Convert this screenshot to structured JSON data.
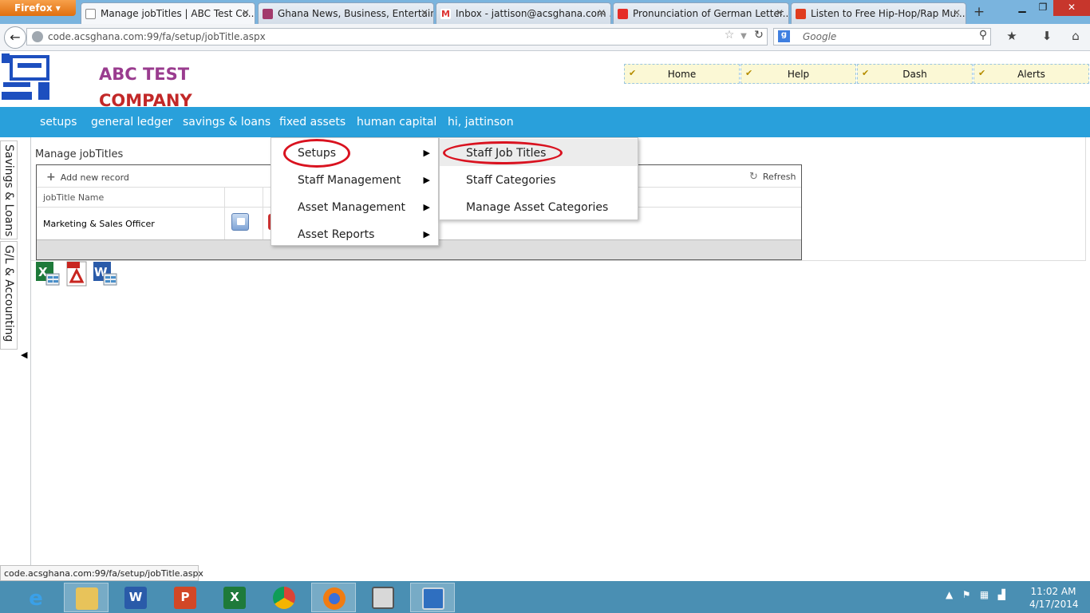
{
  "browser": {
    "menu_label": "Firefox",
    "tabs": [
      {
        "title": "Manage jobTitles | ABC Test Co..."
      },
      {
        "title": "Ghana News, Business, Entertain..."
      },
      {
        "title": "Inbox - jattison@acsghana.com ..."
      },
      {
        "title": "Pronunciation of German Letter..."
      },
      {
        "title": "Listen to Free Hip-Hop/Rap Mu..."
      }
    ],
    "new_tab": "+",
    "url": "code.acsghana.com:99/fa/setup/jobTitle.aspx",
    "search_placeholder": "Google",
    "status_url": "code.acsghana.com:99/fa/setup/jobTitle.aspx"
  },
  "header": {
    "company_line1": "ABC TEST",
    "company_line2": "COMPANY",
    "quicknav": [
      "Home",
      "Help",
      "Dash",
      "Alerts"
    ]
  },
  "mainmenu": [
    "setups",
    "general ledger",
    "savings & loans",
    "fixed assets",
    "human capital",
    "hi, jattinson"
  ],
  "sidebar": {
    "tab1": "Savings & Loans",
    "tab2": "G/L & Accounting"
  },
  "content": {
    "title": "Manage jobTitles",
    "add_record": "Add new record",
    "refresh": "Refresh",
    "column_header": "jobTitle Name",
    "rows": [
      {
        "name": "Marketing & Sales Officer"
      }
    ]
  },
  "dropdown_fixed_assets": [
    "Setups",
    "Staff Management",
    "Asset Management",
    "Asset Reports"
  ],
  "dropdown_setups": [
    "Staff Job Titles",
    "Staff Categories",
    "Manage Asset Categories"
  ],
  "taskbar": {
    "time": "11:02 AM",
    "date": "4/17/2014"
  },
  "colors": {
    "menu_bar": "#29a0db",
    "company_purple": "#9a3c8f",
    "company_red": "#c22828",
    "highlight_oval": "#d9121f"
  }
}
